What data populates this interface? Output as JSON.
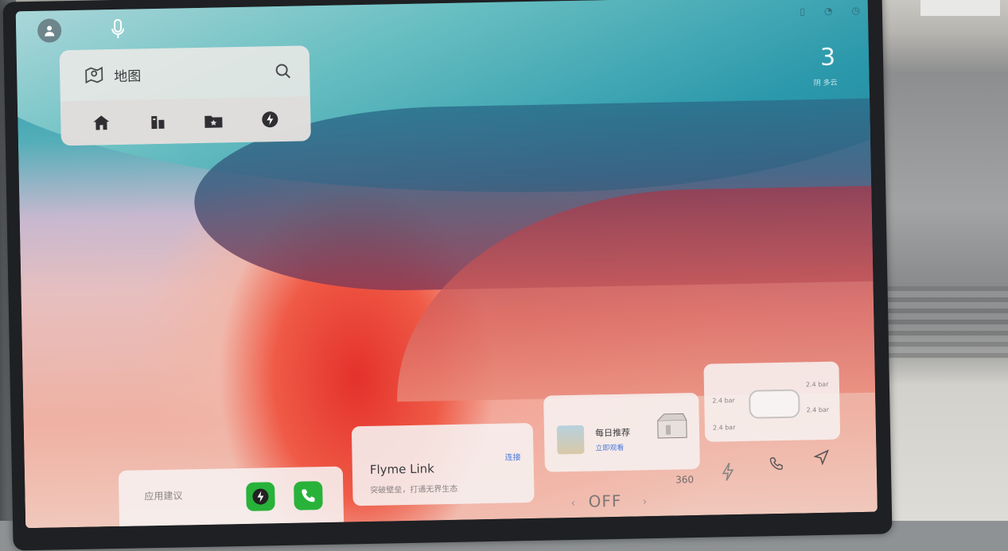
{
  "map_widget": {
    "title": "地图",
    "shortcuts": [
      "home-icon",
      "company-icon",
      "favorites-icon",
      "charging-icon"
    ]
  },
  "weather": {
    "value": "3",
    "label": "阴 多云"
  },
  "cards": {
    "apps": {
      "title": "应用建议"
    },
    "flyme": {
      "title": "Flyme Link",
      "subtitle": "突破壁垒，打通无界生态",
      "link": "连接"
    },
    "daily": {
      "title": "每日推荐",
      "subtitle": "立即观看"
    },
    "tire": {
      "fl": "2.4 bar",
      "fr": "2.4 bar",
      "rl": "2.4 bar",
      "rr": "2.4 bar"
    }
  },
  "dock": {
    "climate": "OFF",
    "camera": "360"
  },
  "colors": {
    "accent": "#4a7adb",
    "app_green": "#28b23a"
  }
}
